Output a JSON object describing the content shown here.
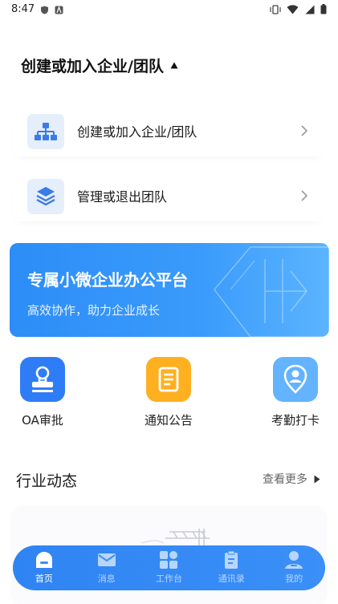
{
  "status_bar": {
    "time": "8:47"
  },
  "header": {
    "title": "创建或加入企业/团队"
  },
  "menu": [
    {
      "label": "创建或加入企业/团队",
      "icon": "org-chart-icon"
    },
    {
      "label": "管理或退出团队",
      "icon": "layers-icon"
    }
  ],
  "banner": {
    "title": "专属小微企业办公平台",
    "subtitle": "高效协作，助力企业成长"
  },
  "quick_actions": [
    {
      "label": "OA审批",
      "icon": "stamp-icon",
      "color": "#2f7df6"
    },
    {
      "label": "通知公告",
      "icon": "notice-icon",
      "color": "#ffb020"
    },
    {
      "label": "考勤打卡",
      "icon": "location-user-icon",
      "color": "#63b3ff"
    }
  ],
  "section": {
    "title": "行业动态",
    "more": "查看更多"
  },
  "tabbar": [
    {
      "label": "首页",
      "icon": "home-icon",
      "active": true
    },
    {
      "label": "消息",
      "icon": "mail-icon",
      "active": false
    },
    {
      "label": "工作台",
      "icon": "grid-icon",
      "active": false
    },
    {
      "label": "通讯录",
      "icon": "contacts-icon",
      "active": false
    },
    {
      "label": "我的",
      "icon": "user-icon",
      "active": false
    }
  ],
  "colors": {
    "primary": "#2f84f3",
    "icon_bg": "#e5eefb"
  }
}
